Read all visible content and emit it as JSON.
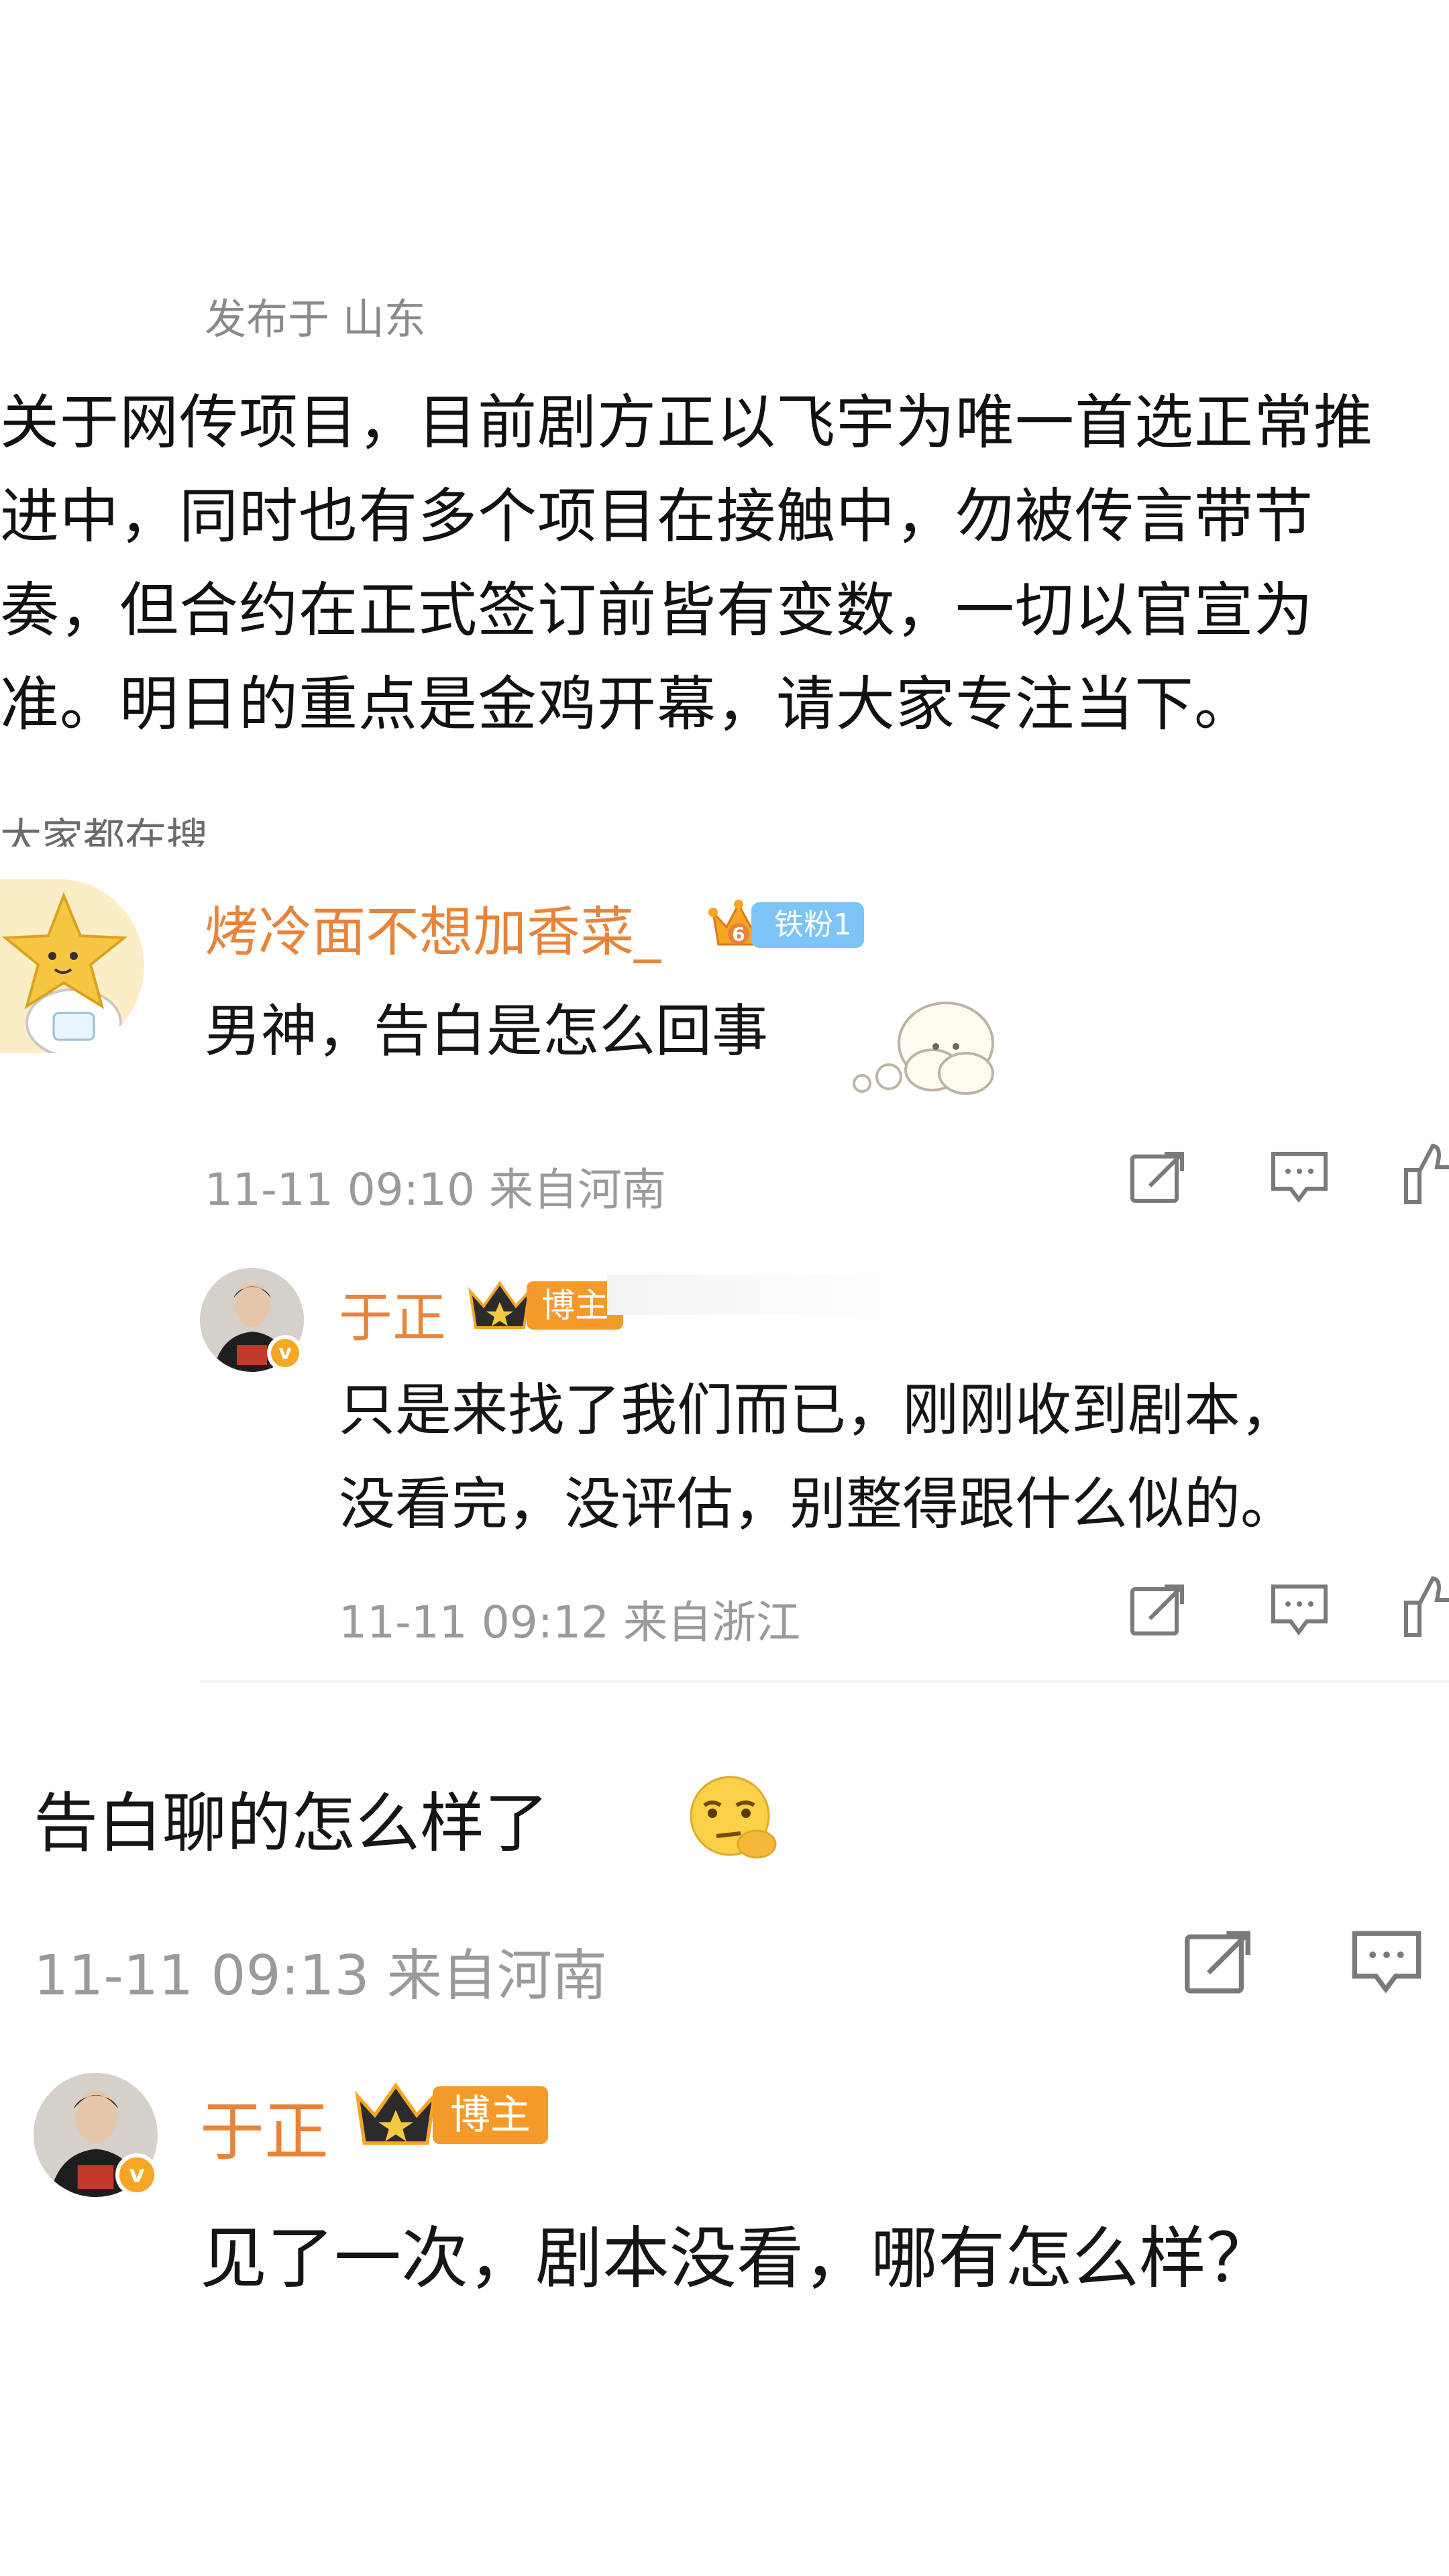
{
  "post": {
    "published_from": "发布于 山东",
    "body_lines": [
      "关于网传项目，目前剧方正以飞宇为唯一首选正常推",
      "进中，同时也有多个项目在接触中，勿被传言带节",
      "奏，但合约在正式签订前皆有变数，一切以官宣为",
      "准。明日的重点是金鸡开幕，请大家专注当下。"
    ],
    "cut_text": "大家都在搜"
  },
  "comments": [
    {
      "username": "烤冷面不想加香菜_",
      "badge_level": "6",
      "badge_label": "铁粉1",
      "text": "男神，告白是怎么回事",
      "meta": "11-11 09:10 来自河南",
      "reply": {
        "username": "于正",
        "badge_label": "博主",
        "text_lines": [
          "只是来找了我们而已，刚刚收到剧本，",
          "没看完，没评估，别整得跟什么似的。"
        ],
        "meta": "11-11 09:12 来自浙江"
      }
    },
    {
      "text": "告白聊的怎么样了",
      "meta": "11-11 09:13 来自河南",
      "reply": {
        "username": "于正",
        "badge_label": "博主",
        "text": "见了一次，剧本没看，哪有怎么样？"
      }
    }
  ],
  "icons": {
    "share": "share-icon",
    "reply": "comment-icon",
    "like": "like-icon"
  },
  "colors": {
    "username": "#e8843a",
    "host_badge": "#f39a2b",
    "fan_badge": "#7cc4f5",
    "meta_text": "#9a9a9a"
  }
}
